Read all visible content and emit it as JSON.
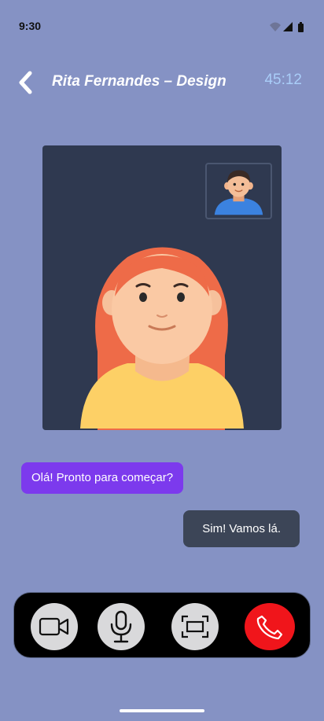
{
  "status_bar": {
    "time": "9:30"
  },
  "header": {
    "title": "Rita Fernandes – Design",
    "timer": "45:12"
  },
  "messages": [
    {
      "text": "Olá! Pronto para começar?",
      "direction": "incoming"
    },
    {
      "text": "Sim! Vamos lá.",
      "direction": "outgoing"
    }
  ],
  "controls": [
    {
      "icon": "video-camera-icon",
      "action": "toggle-video"
    },
    {
      "icon": "microphone-icon",
      "action": "toggle-mic"
    },
    {
      "icon": "screen-share-icon",
      "action": "share-screen"
    },
    {
      "icon": "end-call-icon",
      "action": "end-call"
    }
  ],
  "colors": {
    "background": "#8592C4",
    "video_panel": "#2F3950",
    "incoming_bubble": "#7C3AED",
    "outgoing_bubble": "#3C4557",
    "timer": "#A9CDF8",
    "end_call": "#F0151B"
  }
}
